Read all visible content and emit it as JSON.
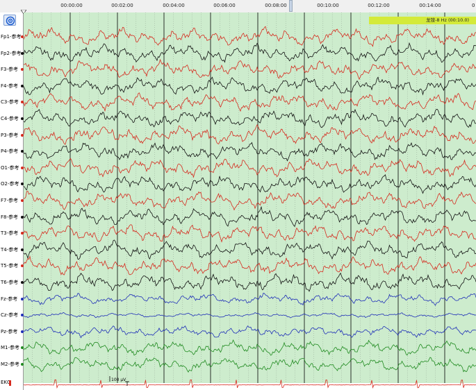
{
  "timebar": {
    "ticks": [
      "00:00:00",
      "00:02:00",
      "00:04:00",
      "00:06:00",
      "00:08:00",
      "00:10:00",
      "00:12:00",
      "00:14:00",
      "0"
    ]
  },
  "annotation": {
    "text": "龙铵-8 Hz (00:10.0)"
  },
  "scale_label": "100 µV",
  "channels": [
    {
      "name": "Fp1-参考",
      "color": "#d62a1e"
    },
    {
      "name": "Fp2-参考",
      "color": "#111111"
    },
    {
      "name": "F3-参考",
      "color": "#d62a1e"
    },
    {
      "name": "F4-参考",
      "color": "#111111"
    },
    {
      "name": "C3-参考",
      "color": "#d62a1e"
    },
    {
      "name": "C4-参考",
      "color": "#111111"
    },
    {
      "name": "P3-参考",
      "color": "#d62a1e"
    },
    {
      "name": "P4-参考",
      "color": "#111111"
    },
    {
      "name": "O1-参考",
      "color": "#d62a1e"
    },
    {
      "name": "O2-参考",
      "color": "#111111"
    },
    {
      "name": "F7-参考",
      "color": "#d62a1e"
    },
    {
      "name": "F8-参考",
      "color": "#111111"
    },
    {
      "name": "T3-参考",
      "color": "#d62a1e"
    },
    {
      "name": "T4-参考",
      "color": "#111111"
    },
    {
      "name": "T5-参考",
      "color": "#d62a1e"
    },
    {
      "name": "T6-参考",
      "color": "#111111"
    },
    {
      "name": "Fz-参考",
      "color": "#1f2fb8"
    },
    {
      "name": "Cz-参考",
      "color": "#1f2fb8"
    },
    {
      "name": "Pz-参考",
      "color": "#1f2fb8"
    },
    {
      "name": "M1-参考",
      "color": "#1f8a1f"
    },
    {
      "name": "M2-参考",
      "color": "#1f8a1f"
    },
    {
      "name": "EKG",
      "color": "#d62a1e"
    }
  ],
  "colors": {
    "plot_background": "#cdeccd",
    "grid_major": "#000000",
    "grid_minor": "#8fa08f",
    "annotation_bg": "#d4ea3a"
  },
  "icons": {
    "nav_button": "target-icon"
  }
}
